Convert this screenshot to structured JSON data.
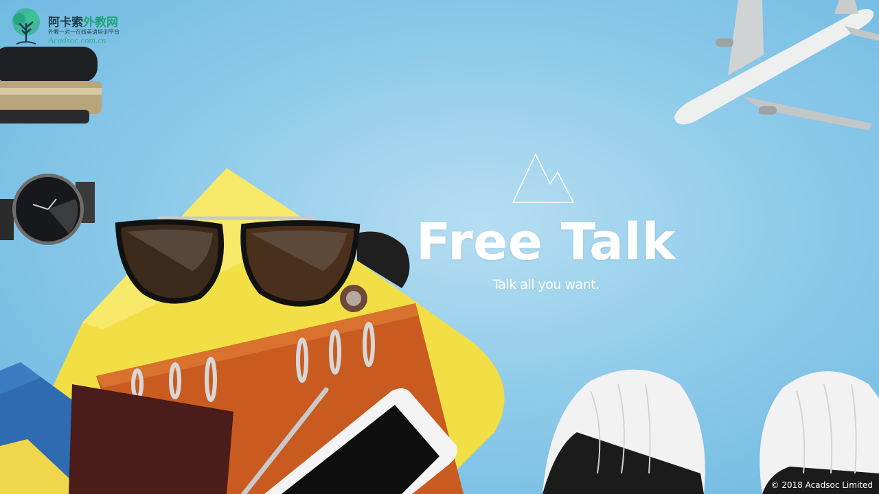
{
  "logo": {
    "brand_main": "阿卡索",
    "brand_accent": "外教网",
    "tagline": "外教一对一在线英语培训平台",
    "domain": "Acadsoc.com.cn"
  },
  "slide": {
    "title": "Free Talk",
    "subtitle": "Talk all you want."
  },
  "footer": {
    "copyright": "© 2018 Acadsoc Limited"
  },
  "colors": {
    "background": "#8fcbea",
    "title": "#ffffff",
    "logo_green": "#22a37a"
  },
  "icons": [
    "mountain-icon",
    "tree-logo-icon"
  ]
}
